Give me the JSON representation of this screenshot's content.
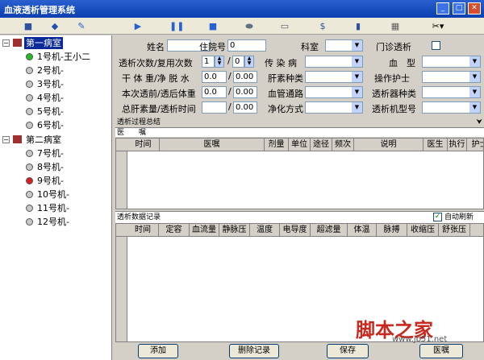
{
  "window": {
    "title": "血液透析管理系统"
  },
  "tree": {
    "ward1": {
      "label": "第一病室"
    },
    "ward1_items": [
      {
        "label": "1号机-王小二",
        "status": "green"
      },
      {
        "label": "2号机-"
      },
      {
        "label": "3号机-"
      },
      {
        "label": "4号机-"
      },
      {
        "label": "5号机-"
      },
      {
        "label": "6号机-"
      }
    ],
    "ward2": {
      "label": "第二病室"
    },
    "ward2_items": [
      {
        "label": "7号机-"
      },
      {
        "label": "8号机-"
      },
      {
        "label": "9号机-",
        "status": "red"
      },
      {
        "label": "10号机-"
      },
      {
        "label": "11号机-"
      },
      {
        "label": "12号机-"
      }
    ]
  },
  "form": {
    "name_label": "姓名",
    "hosp_label": "住院号",
    "hosp_value": "0",
    "dept_label": "科室",
    "outpatient_label": "门诊透析",
    "dialysis_count_label": "透析次数/复用次数",
    "dialysis_count": "1",
    "reuse_count": "0",
    "infectious_label": "传 染 病",
    "blood_label": "血　型",
    "weight_label": "干 体 重/净 脱 水",
    "dry_weight": "0.0",
    "dehydration": "0.00",
    "heparin_label": "肝素种类",
    "nurse_label": "操作护士",
    "pre_post_label": "本次透前/透后体重",
    "pre_weight": "0.0",
    "post_weight": "0.00",
    "access_label": "血管通路",
    "dialyzer_type_label": "透析器种类",
    "heparin_total_label": "总肝素量/透析时间",
    "heparin_total": "",
    "dialysis_time": "0.00",
    "method_label": "净化方式",
    "machine_model_label": "透析机型号"
  },
  "process": {
    "section_label": "透析过程总结",
    "orders_label": "医　　嘱",
    "columns": [
      "时间",
      "医嘱",
      "剂量",
      "单位",
      "途径",
      "频次",
      "说明",
      "医生",
      "执行",
      "护士"
    ]
  },
  "records": {
    "section_label": "透析数据记录",
    "auto_refresh_label": "自动刷新",
    "columns": [
      "时间",
      "定容",
      "血流量",
      "静脉压",
      "温度",
      "电导度",
      "超滤量",
      "体温",
      "脉搏",
      "收缩压",
      "舒张压"
    ]
  },
  "buttons": {
    "add": "添加",
    "delete": "删除记录",
    "save": "保存",
    "orders": "医嘱"
  },
  "watermark": {
    "main": "脚本之家",
    "url": "www.jb51.net"
  },
  "chart_data": {
    "type": "table",
    "columns": [
      "时间",
      "定容",
      "血流量",
      "静脉压",
      "温度",
      "电导度",
      "超滤量",
      "体温",
      "脉搏",
      "收缩压",
      "舒张压"
    ],
    "rows": []
  }
}
